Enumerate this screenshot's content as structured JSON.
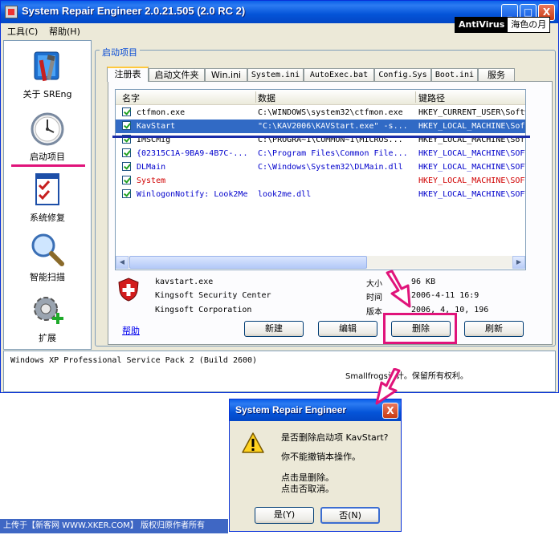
{
  "window": {
    "title": "System Repair Engineer 2.0.21.505 (2.0 RC 2)",
    "minimize": "_",
    "maximize": "□",
    "close": "X"
  },
  "antivirus_badge": {
    "left": "AntiVirus",
    "right": "海色の月"
  },
  "menu": {
    "tools": "工具(C)",
    "help": "帮助(H)"
  },
  "sidebar": {
    "items": [
      {
        "label": "关于 SREng",
        "icon": "tools-icon"
      },
      {
        "label": "启动项目",
        "icon": "clock-icon"
      },
      {
        "label": "系统修复",
        "icon": "checklist-icon"
      },
      {
        "label": "智能扫描",
        "icon": "magnifier-icon"
      },
      {
        "label": "扩展",
        "icon": "gear-plus-icon"
      }
    ]
  },
  "group_title": "启动项目",
  "tabs": [
    "注册表",
    "启动文件夹",
    "Win.ini",
    "System.ini",
    "AutoExec.bat",
    "Config.Sys",
    "Boot.ini",
    "服务"
  ],
  "list": {
    "columns": [
      "名字",
      "数据",
      "键路径"
    ],
    "rows": [
      {
        "name": "ctfmon.exe",
        "data": "C:\\WINDOWS\\system32\\ctfmon.exe",
        "path": "HKEY_CURRENT_USER\\Software",
        "style": ""
      },
      {
        "name": "KavStart",
        "data": "\"C:\\KAV2006\\KAVStart.exe\" -s...",
        "path": "HKEY_LOCAL_MACHINE\\Software",
        "style": "sel"
      },
      {
        "name": "IMSCMig",
        "data": "C:\\PROGRA~1\\COMMON~1\\MICROS...",
        "path": "HKEY_LOCAL_MACHINE\\Software",
        "style": ""
      },
      {
        "name": "{02315C1A-9BA9-4B7C-...",
        "data": "C:\\Program Files\\Common File...",
        "path": "HKEY_LOCAL_MACHINE\\SOFTWARE",
        "style": "blue"
      },
      {
        "name": "DLMain",
        "data": "C:\\Windows\\System32\\DLMain.dll",
        "path": "HKEY_LOCAL_MACHINE\\SOFTWARE",
        "style": "blue"
      },
      {
        "name": "System",
        "data": "",
        "path": "HKEY_LOCAL_MACHINE\\SOFTWARE",
        "style": "red"
      },
      {
        "name": "WinlogonNotify: Look2Me",
        "data": "look2me.dll",
        "path": "HKEY_LOCAL_MACHINE\\SOFTWARE",
        "style": "blue"
      }
    ]
  },
  "info": {
    "file": "kavstart.exe",
    "description": "Kingsoft Security Center",
    "company": "Kingsoft Corporation",
    "size_label": "大小",
    "size_value": "96 KB",
    "time_label": "时间",
    "time_value": "2006-4-11 16:9",
    "version_label": "版本",
    "version_value": "2006, 4, 10, 196"
  },
  "help_link": "帮助",
  "buttons": {
    "new": "新建",
    "edit": "编辑",
    "delete": "删除",
    "refresh": "刷新"
  },
  "status_text": "Windows XP Professional Service Pack 2 (Build 2600)",
  "copyright": "Smallfrogs设计。保留所有权利。",
  "dialog": {
    "title": "System Repair Engineer",
    "close": "X",
    "line1": "是否删除启动项 KavStart?",
    "line2": "你不能撤销本操作。",
    "line3": "点击是删除。",
    "line4": "点击否取消。",
    "yes": "是(Y)",
    "no": "否(N)"
  },
  "footer": "上传于【新客网 WWW.XKER.COM】 版权归原作者所有",
  "colors": {
    "highlight": "#e0137a",
    "selection": "#316ac5",
    "title_bar": "#0454d8"
  }
}
